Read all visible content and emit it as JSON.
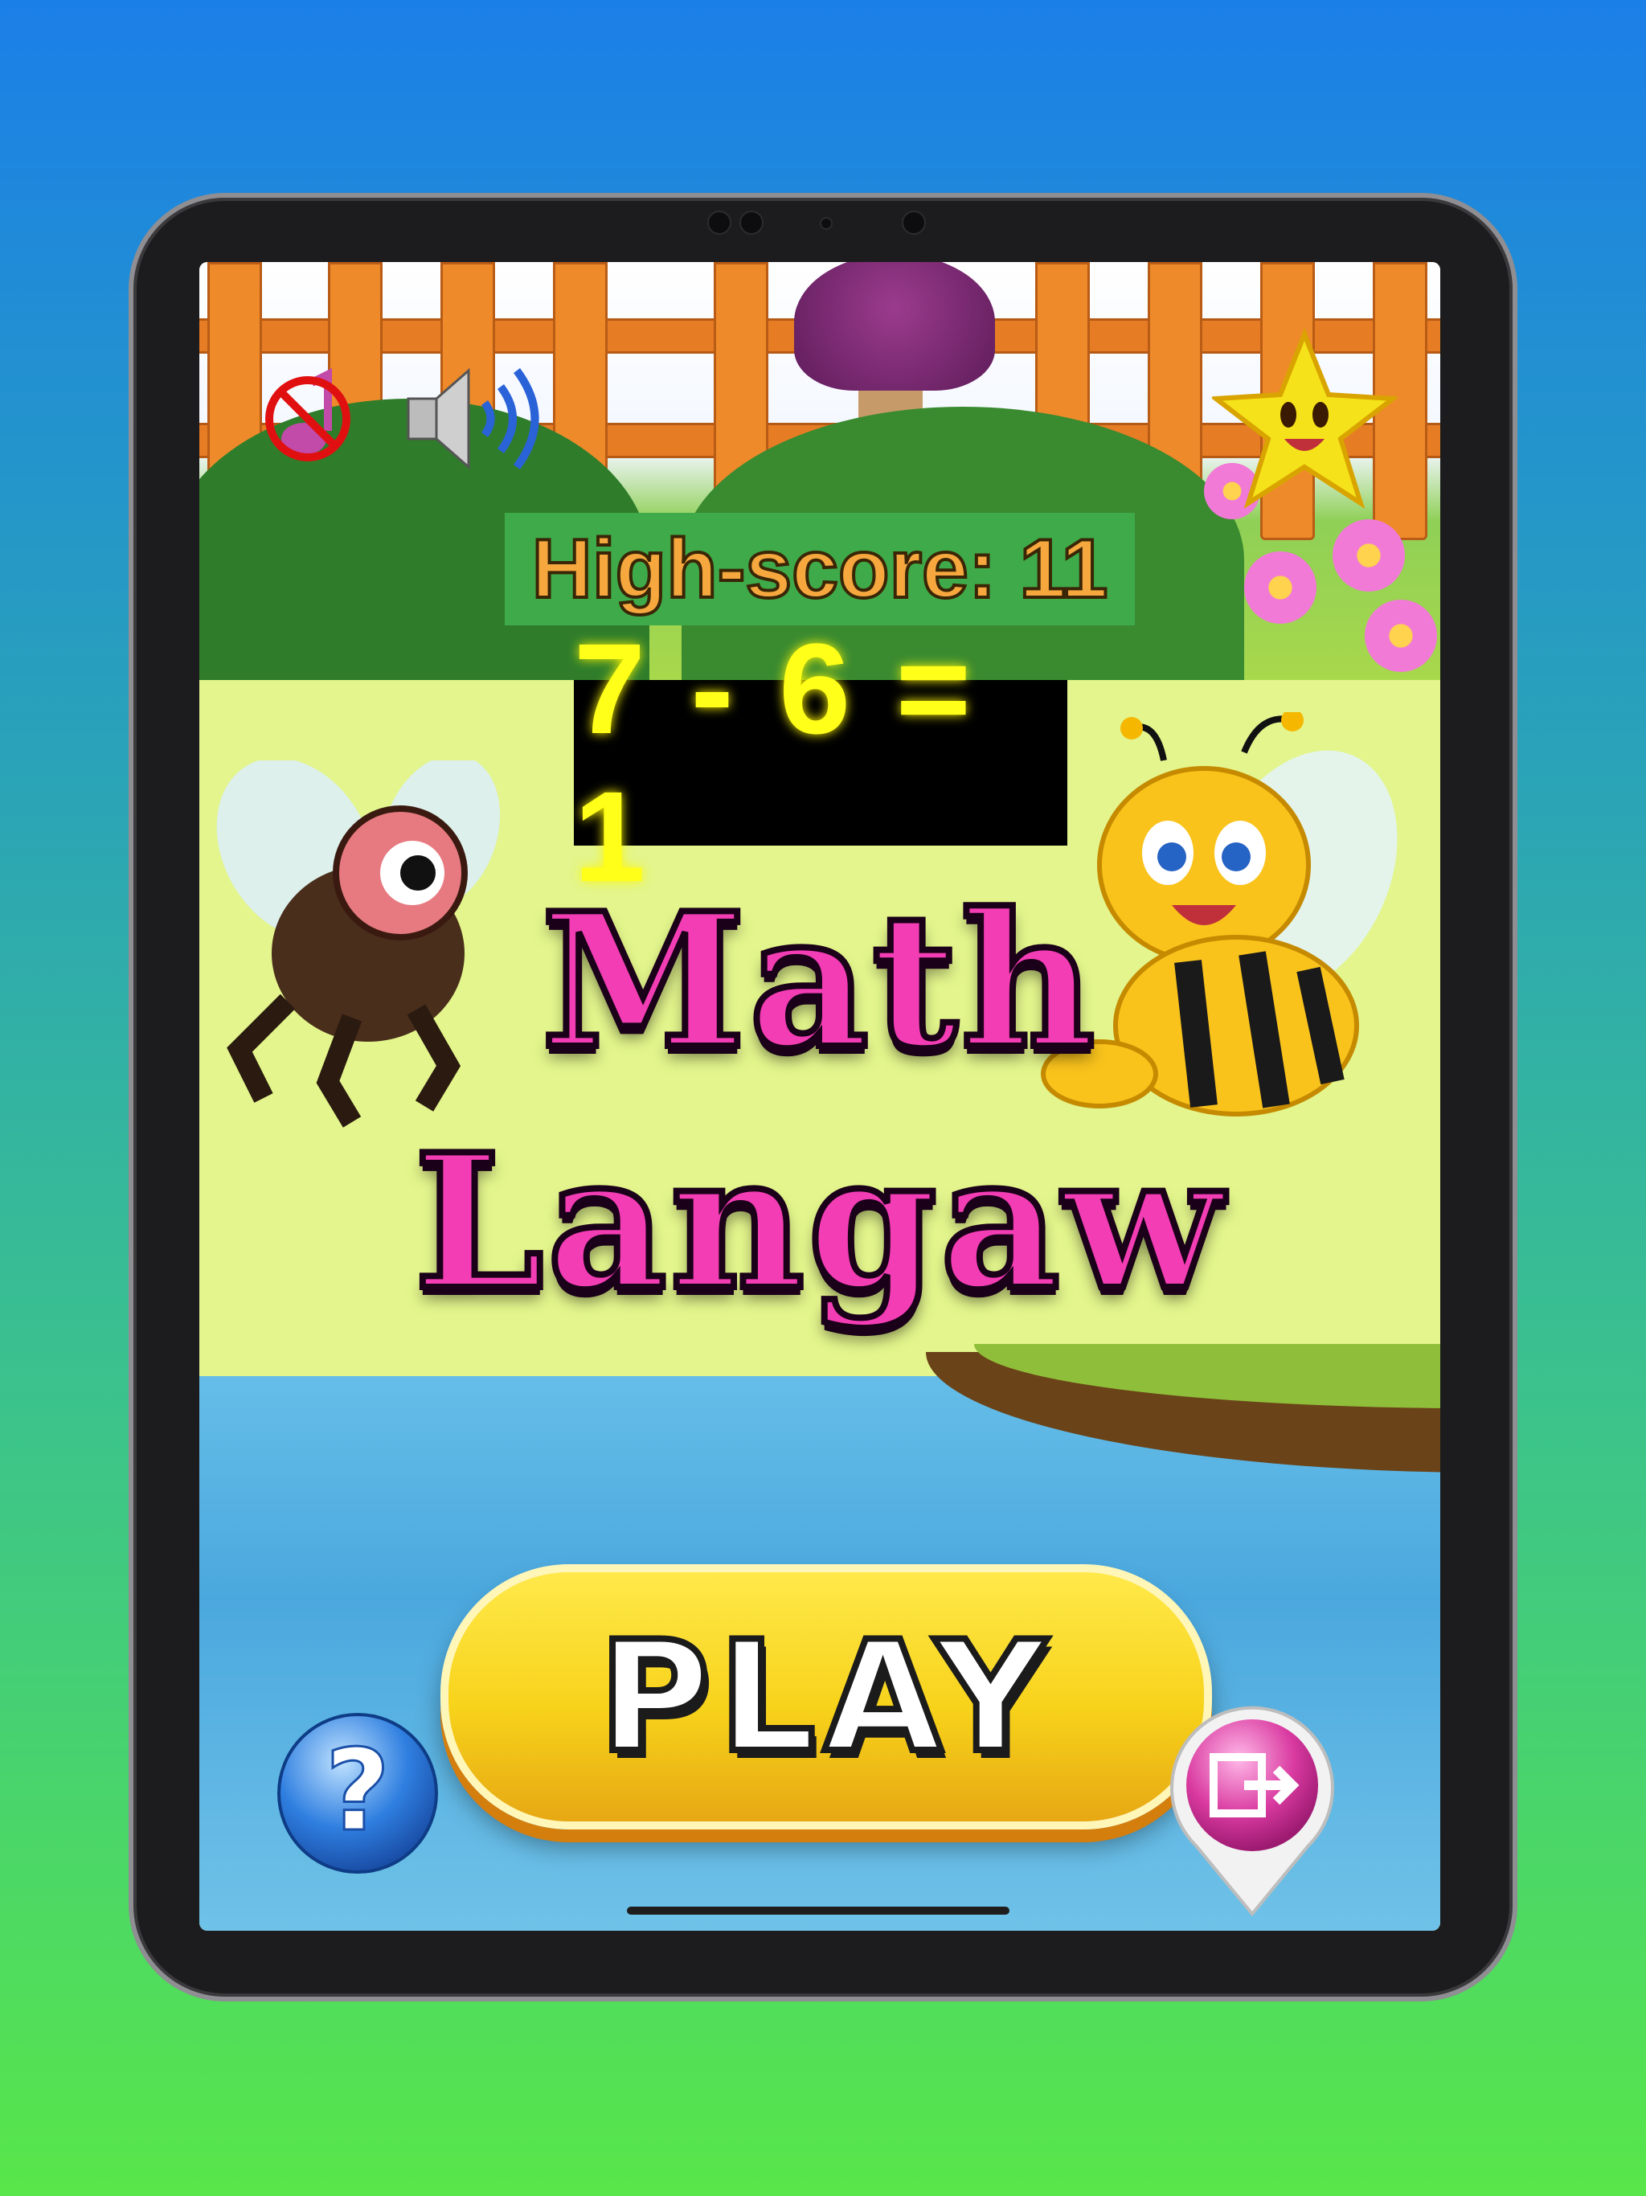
{
  "hud": {
    "music_icon": "music-muted-icon",
    "sound_icon": "speaker-on-icon",
    "star_icon": "star-icon",
    "high_score": "High-score: 11"
  },
  "equation": "7 - 6 = 1",
  "title": {
    "line1": "Math",
    "line2": "Langaw"
  },
  "buttons": {
    "play": "PLAY",
    "help": "?",
    "exit_icon": "exit-icon"
  },
  "colors": {
    "title": "#f23db4",
    "equation": "#ffff1a",
    "high_score": "#f6a83e",
    "play_button": "#f7d21a"
  }
}
